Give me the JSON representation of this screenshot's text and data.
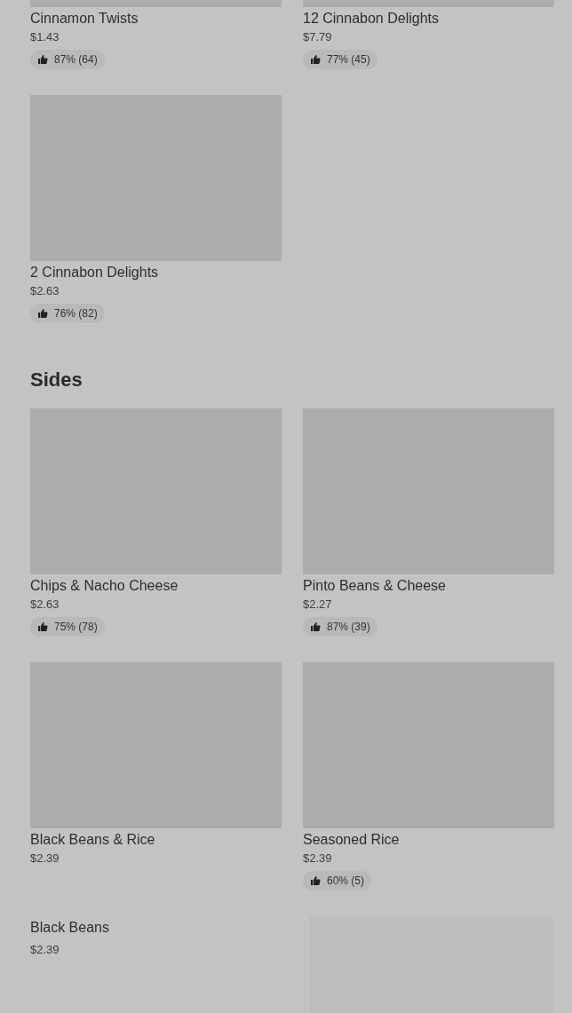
{
  "sections": [
    {
      "items": [
        {
          "kind": "tile",
          "name": "Cinnamon Twists",
          "price": "$1.43",
          "rating": "87% (64)"
        },
        {
          "kind": "tile",
          "name": "12 Cinnabon Delights",
          "price": "$7.79",
          "rating": "77% (45)"
        },
        {
          "kind": "tile",
          "name": "2 Cinnabon Delights",
          "price": "$2.63",
          "rating": "76% (82)"
        }
      ]
    },
    {
      "title": "Sides",
      "items": [
        {
          "kind": "tile",
          "name": "Chips & Nacho Cheese",
          "price": "$2.63",
          "rating": "75% (78)"
        },
        {
          "kind": "tile",
          "name": "Pinto Beans & Cheese",
          "price": "$2.27",
          "rating": "87% (39)"
        },
        {
          "kind": "tile",
          "name": "Black Beans & Rice",
          "price": "$2.39"
        },
        {
          "kind": "tile",
          "name": "Seasoned Rice",
          "price": "$2.39",
          "rating": "60% (5)"
        },
        {
          "kind": "row",
          "name": "Black Beans",
          "price": "$2.39"
        }
      ]
    }
  ]
}
